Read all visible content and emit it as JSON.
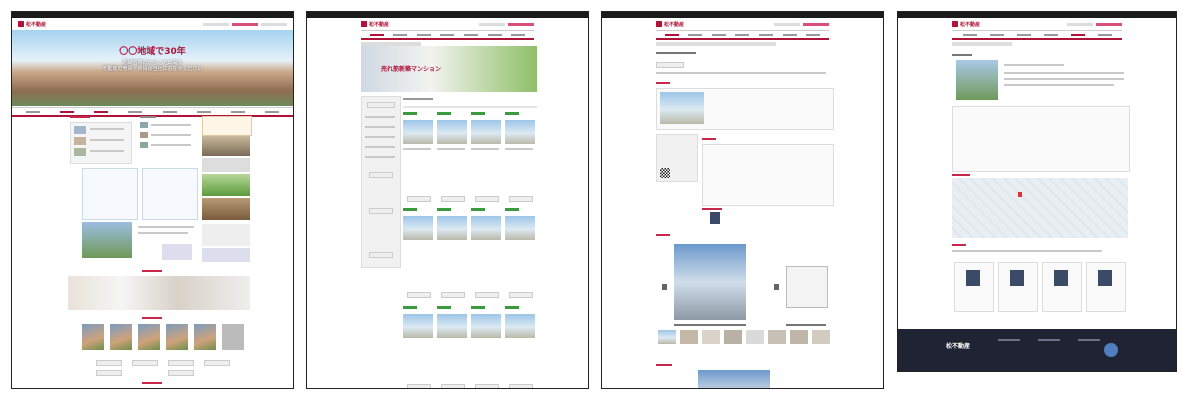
{
  "site": {
    "logo_text": "松不動産",
    "footer_logo_text": "松不動産"
  },
  "page1": {
    "hero_title": "〇〇地域で30年",
    "hero_sub_line1": "地域密着だからこそ出来る",
    "hero_sub_line2": "不動産の売買・賃貸は当社にお任せください"
  },
  "page2": {
    "banner_title": "売れ筋新築マンション"
  },
  "colors": {
    "brand": "#b0133a",
    "footer": "#1f2333",
    "badge_green": "#3a9b3e"
  }
}
